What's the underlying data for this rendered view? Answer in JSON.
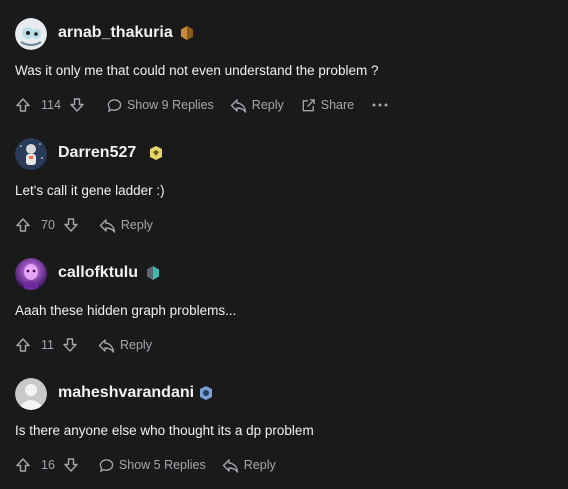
{
  "comments": [
    {
      "username": "arnab_thakuria",
      "badge_color": "#c98a3c",
      "text": "Was it only me that could not even understand the problem ?",
      "votes": "114",
      "replies": "Show 9 Replies",
      "reply": "Reply",
      "share": "Share"
    },
    {
      "username": "Darren527",
      "badge_color": "#e7d56b",
      "text": "Let's call it gene ladder :)",
      "votes": "70",
      "reply": "Reply"
    },
    {
      "username": "callofktulu",
      "badge_color": "#3fb8b0",
      "text": "Aaah these hidden graph problems...",
      "votes": "11",
      "reply": "Reply"
    },
    {
      "username": "maheshvarandani",
      "badge_color": "#7b9fd8",
      "text": "Is there anyone else who thought its a dp problem",
      "votes": "16",
      "replies": "Show 5 Replies",
      "reply": "Reply"
    }
  ]
}
